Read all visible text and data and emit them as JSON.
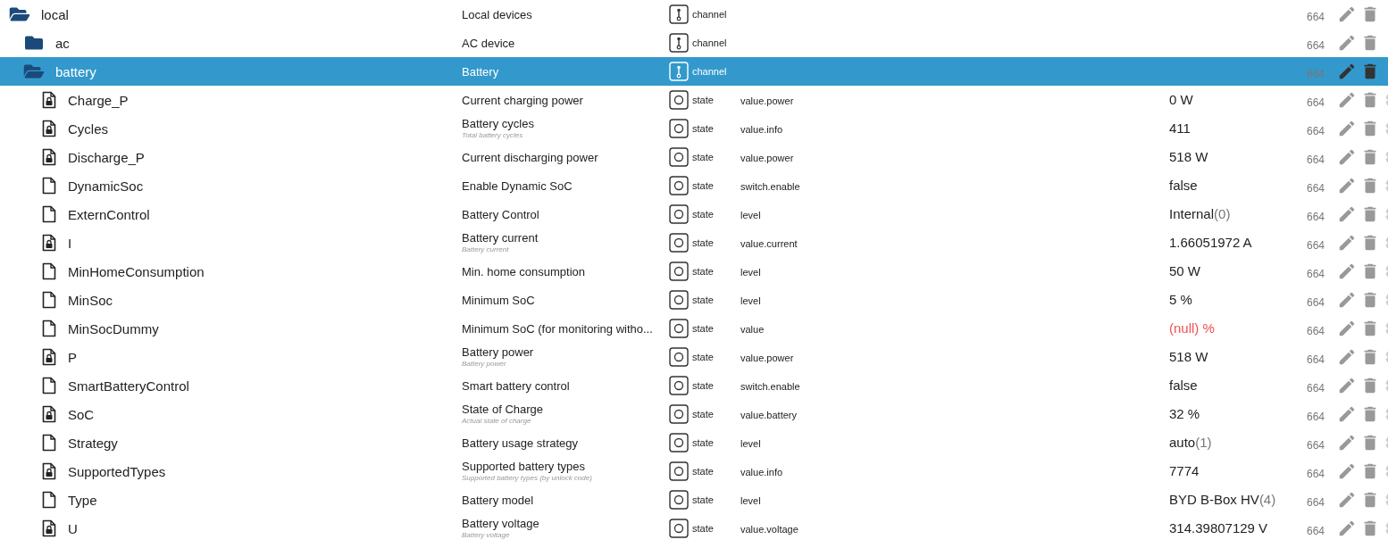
{
  "tree": [
    {
      "kind": "folder",
      "name": "local",
      "description": "Local devices",
      "type": "channel",
      "acl": "664",
      "expanded": true,
      "selected": false,
      "children": [
        {
          "kind": "folder",
          "name": "ac",
          "description": "AC device",
          "type": "channel",
          "acl": "664",
          "expanded": false,
          "selected": false
        },
        {
          "kind": "folder",
          "name": "battery",
          "description": "Battery",
          "type": "channel",
          "acl": "664",
          "expanded": true,
          "selected": true,
          "children": [
            {
              "kind": "state",
              "name": "Charge_P",
              "description": "Current charging power",
              "type": "state",
              "role": "value.power",
              "value": "0 W",
              "acl": "664",
              "locked": true,
              "null": false,
              "selected": false
            },
            {
              "kind": "state",
              "name": "Cycles",
              "description": "Battery cycles",
              "subtitle": "Total battery cycles",
              "type": "state",
              "role": "value.info",
              "value": "411",
              "acl": "664",
              "locked": true,
              "null": false,
              "selected": false
            },
            {
              "kind": "state",
              "name": "Discharge_P",
              "description": "Current discharging power",
              "type": "state",
              "role": "value.power",
              "value": "518 W",
              "acl": "664",
              "locked": true,
              "null": false,
              "selected": false
            },
            {
              "kind": "state",
              "name": "DynamicSoc",
              "description": "Enable Dynamic SoC",
              "type": "state",
              "role": "switch.enable",
              "value": "false",
              "acl": "664",
              "locked": false,
              "null": false,
              "selected": false
            },
            {
              "kind": "state",
              "name": "ExternControl",
              "description": "Battery Control",
              "type": "state",
              "role": "level",
              "value": "Internal",
              "value_suffix": "(0)",
              "acl": "664",
              "locked": false,
              "null": false,
              "selected": false
            },
            {
              "kind": "state",
              "name": "I",
              "description": "Battery current",
              "subtitle": "Battery current",
              "type": "state",
              "role": "value.current",
              "value": "1.66051972 A",
              "acl": "664",
              "locked": true,
              "null": false,
              "selected": false
            },
            {
              "kind": "state",
              "name": "MinHomeConsumption",
              "description": "Min. home consumption",
              "type": "state",
              "role": "level",
              "value": "50 W",
              "acl": "664",
              "locked": false,
              "null": false,
              "selected": false
            },
            {
              "kind": "state",
              "name": "MinSoc",
              "description": "Minimum SoC",
              "type": "state",
              "role": "level",
              "value": "5 %",
              "acl": "664",
              "locked": false,
              "null": false,
              "selected": false
            },
            {
              "kind": "state",
              "name": "MinSocDummy",
              "description": "Minimum SoC (for monitoring witho...",
              "type": "state",
              "role": "value",
              "value": "(null) %",
              "acl": "664",
              "locked": false,
              "null": true,
              "selected": false
            },
            {
              "kind": "state",
              "name": "P",
              "description": "Battery power",
              "subtitle": "Battery power",
              "type": "state",
              "role": "value.power",
              "value": "518 W",
              "acl": "664",
              "locked": true,
              "null": false,
              "selected": false
            },
            {
              "kind": "state",
              "name": "SmartBatteryControl",
              "description": "Smart battery control",
              "type": "state",
              "role": "switch.enable",
              "value": "false",
              "acl": "664",
              "locked": false,
              "null": false,
              "selected": false
            },
            {
              "kind": "state",
              "name": "SoC",
              "description": "State of Charge",
              "subtitle": "Actual state of charge",
              "type": "state",
              "role": "value.battery",
              "value": "32 %",
              "acl": "664",
              "locked": true,
              "null": false,
              "selected": false
            },
            {
              "kind": "state",
              "name": "Strategy",
              "description": "Battery usage strategy",
              "type": "state",
              "role": "level",
              "value": "auto",
              "value_suffix": "(1)",
              "acl": "664",
              "locked": false,
              "null": false,
              "selected": false
            },
            {
              "kind": "state",
              "name": "SupportedTypes",
              "description": "Supported battery types",
              "subtitle": "Supported battery types (by unlock code)",
              "type": "state",
              "role": "value.info",
              "value": "7774",
              "acl": "664",
              "locked": true,
              "null": false,
              "selected": false
            },
            {
              "kind": "state",
              "name": "Type",
              "description": "Battery model",
              "type": "state",
              "role": "level",
              "value": "BYD B-Box HV",
              "value_suffix": "(4)",
              "acl": "664",
              "locked": false,
              "null": false,
              "selected": false
            },
            {
              "kind": "state",
              "name": "U",
              "description": "Battery voltage",
              "subtitle": "Battery voltage",
              "type": "state",
              "role": "value.voltage",
              "value": "314.39807129 V",
              "acl": "664",
              "locked": true,
              "null": false,
              "selected": false
            }
          ]
        }
      ]
    }
  ]
}
